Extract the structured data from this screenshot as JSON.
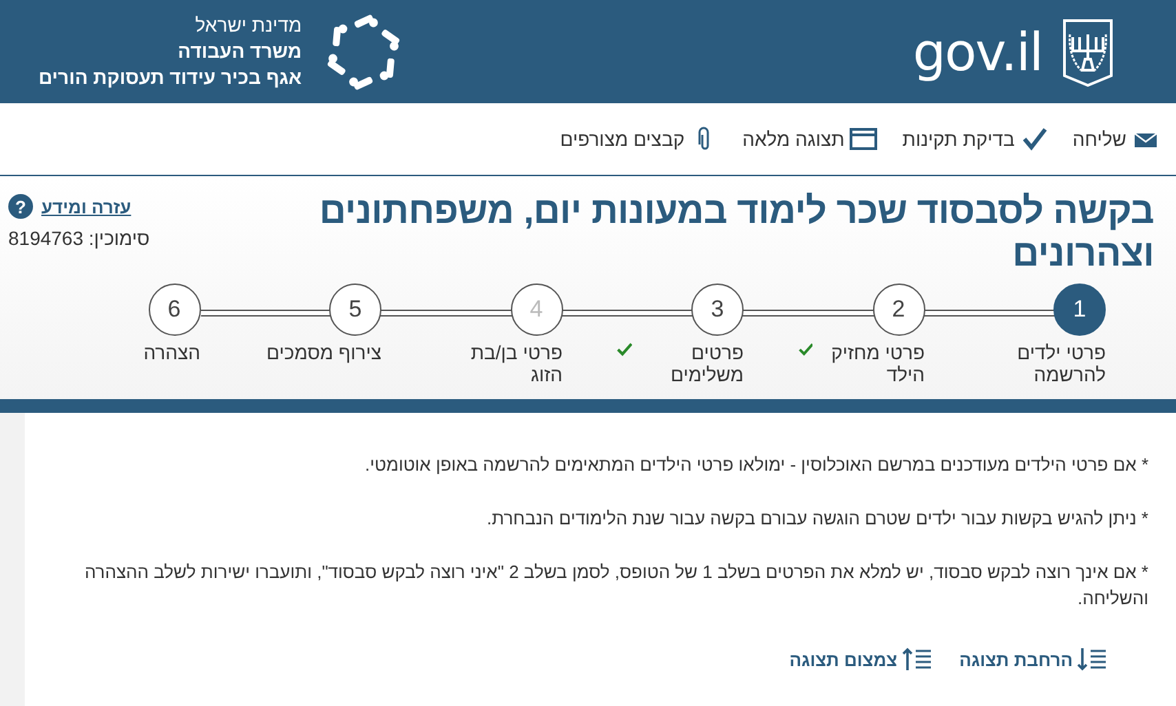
{
  "header": {
    "logo_text": "gov.il",
    "ministry_lines": [
      {
        "text": "מדינת ישראל",
        "kind": "plain"
      },
      {
        "text": "משרד העבודה",
        "kind": "bold"
      },
      {
        "text": "אגף בכיר עידוד תעסוקת הורים",
        "kind": "bold"
      }
    ]
  },
  "toolbar": [
    {
      "label": "שליחה",
      "kind": "send"
    },
    {
      "label": "בדיקת תקינות",
      "kind": "check"
    },
    {
      "label": "תצוגה מלאה",
      "kind": "fullview"
    },
    {
      "label": "קבצים מצורפים",
      "kind": "attach"
    }
  ],
  "title": "בקשה לסבסוד שכר לימוד במעונות יום, משפחתונים וצהרונים",
  "help_link": "עזרה ומידע",
  "help_icon": "?",
  "reference": "סימוכין: 8194763",
  "steps": [
    {
      "number": "1",
      "label": "פרטי ילדים להרשמה",
      "selected": true,
      "done": false,
      "disabled": false
    },
    {
      "number": "2",
      "label": "פרטי מחזיק הילד",
      "selected": false,
      "done": true,
      "disabled": false
    },
    {
      "number": "3",
      "label": "פרטים משלימים",
      "selected": false,
      "done": true,
      "disabled": false
    },
    {
      "number": "4",
      "label": "פרטי בן/בת הזוג",
      "selected": false,
      "done": false,
      "disabled": true
    },
    {
      "number": "5",
      "label": "צירוף מסמכים",
      "selected": false,
      "done": false,
      "disabled": false
    },
    {
      "number": "6",
      "label": "הצהרה",
      "selected": false,
      "done": false,
      "disabled": false
    }
  ],
  "notes": [
    "* אם פרטי הילדים מעודכנים במרשם האוכלוסין - ימולאו פרטי הילדים המתאימים להרשמה באופן אוטומטי.",
    "* ניתן להגיש בקשות עבור ילדים שטרם הוגשה עבורם בקשה עבור שנת הלימודים הנבחרת.",
    "* אם אינך רוצה לבקש סבסוד, יש למלא את הפרטים בשלב 1 של הטופס, לסמן בשלב 2 \"איני רוצה לבקש סבסוד\", ותועברו ישירות לשלב ההצהרה והשליחה."
  ],
  "view_buttons": [
    {
      "label": "הרחבת תצוגה",
      "kind": "expand"
    },
    {
      "label": "צמצום תצוגה",
      "kind": "collapse"
    }
  ]
}
